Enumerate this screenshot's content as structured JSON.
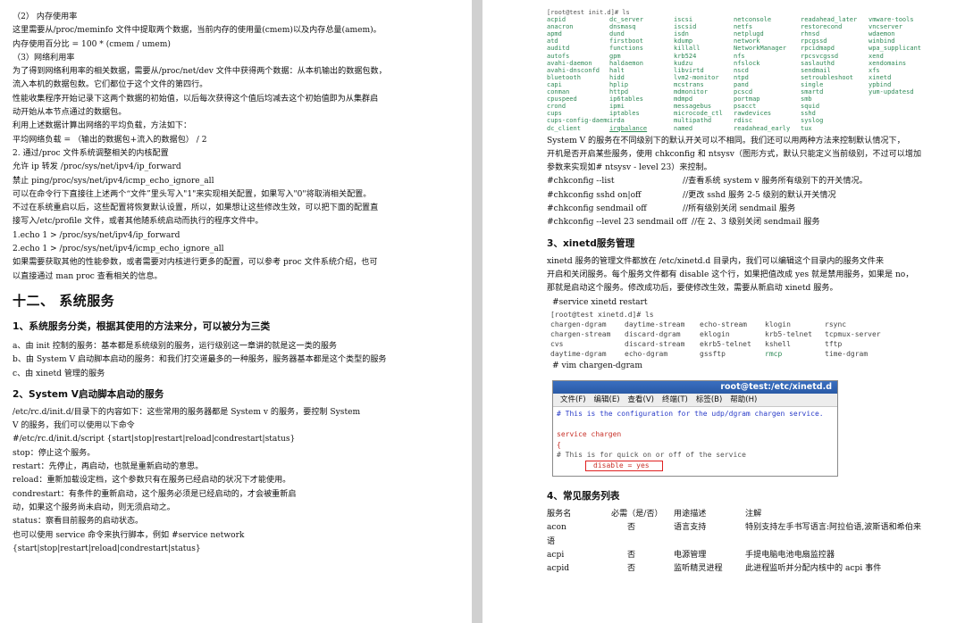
{
  "left": {
    "lines": [
      {
        "k": "ln",
        "t": "（2）      内存使用率"
      },
      {
        "k": "ln",
        "t": "这里需要从/proc/meminfo 文件中提取两个数据，当前内存的使用量(cmem)以及内存总量(amem)。"
      },
      {
        "k": "ln",
        "t": "内存使用百分比      =      100      *      (cmem      /      umem)"
      },
      {
        "k": "ln",
        "t": "（3）网络利用率"
      },
      {
        "k": "ln",
        "t": "为了得到网络利用率的相关数据，需要从/proc/net/dev 文件中获得两个数据：从本机输出的数据包数，"
      },
      {
        "k": "ln",
        "t": "流入本机的数据包数。它们都位于这个文件的第四行。"
      },
      {
        "k": "ln",
        "t": "性能收集程序开始记录下这两个数据的初始值，以后每次获得这个值后均减去这个初始值即为从集群启"
      },
      {
        "k": "ln",
        "t": "动开始从本节点通过的数据包。"
      },
      {
        "k": "ln",
        "t": "利用上述数据计算出网络的平均负载，方法如下："
      },
      {
        "k": "ln",
        "t": "平均网络负载      =      （输出的数据包+流入的数据包）      /      2"
      },
      {
        "k": "ln",
        "t": "2. 通过/proc 文件系统调整相关的内核配置"
      },
      {
        "k": "ln",
        "t": "允许 ip 转发      /proc/sys/net/ipv4/ip_forward"
      },
      {
        "k": "ln",
        "t": "禁止 ping/proc/sys/net/ipv4/icmp_echo_ignore_all"
      },
      {
        "k": "ln",
        "t": "可以在命令行下直接往上述两个“文件”里头写入\"1\"来实现相关配置，如果写入\"0\"将取消相关配置。"
      },
      {
        "k": "ln",
        "t": "不过在系统重启以后，这些配置将恢复默认设置，所以，如果想让这些修改生效，可以把下面的配置直"
      },
      {
        "k": "ln",
        "t": "接写入/etc/profile 文件，或者其他随系统启动而执行的程序文件中。"
      },
      {
        "k": "ln",
        "t": "1.echo 1 > /proc/sys/net/ipv4/ip_forward"
      },
      {
        "k": "ln",
        "t": "2.echo 1 > /proc/sys/net/ipv4/icmp_echo_ignore_all"
      },
      {
        "k": "ln",
        "t": "如果需要获取其他的性能参数，或者需要对内核进行更多的配置，可以参考 proc 文件系统介绍，也可"
      },
      {
        "k": "ln",
        "t": "以直接通过 man proc 查看相关的信息。"
      },
      {
        "k": "h1",
        "t": "十二、 系统服务"
      },
      {
        "k": "h2",
        "t": "1、系统服务分类，根据其使用的方法来分，可以被分为三类"
      },
      {
        "k": "ln",
        "t": "a、由 init 控制的服务：基本都是系统级别的服务，运行级别这一章讲的就是这一类的服务"
      },
      {
        "k": "ln",
        "t": "b、由 System V 启动脚本启动的服务：和我们打交道最多的一种服务，服务器基本都是这个类型的服务"
      },
      {
        "k": "ln",
        "t": "c、由 xinetd 管理的服务"
      },
      {
        "k": "h3",
        "t": "2、System V启动脚本启动的服务"
      },
      {
        "k": "ln",
        "t": "        /etc/rc.d/init.d/目录下的内容如下：这些常用的服务器都是 System v 的服务，要控制 System"
      },
      {
        "k": "ln",
        "t": "V 的服务，我们可以使用以下命令"
      },
      {
        "k": "ln",
        "t": "#/etc/rc.d/init.d/script     {start|stop|restart|reload|condrestart|status}"
      },
      {
        "k": "ln",
        "t": "stop：停止这个服务。"
      },
      {
        "k": "ln",
        "t": "restart：先停止，再启动，也就是重新启动的意思。"
      },
      {
        "k": "ln",
        "t": "reload：重新加载设定档，这个参数只有在服务已经启动的状况下才能使用。"
      },
      {
        "k": "ln",
        "t": "condrestart：有条件的重新启动，这个服务必须是已经启动的，才会被重新启"
      },
      {
        "k": "ln",
        "t": "动，如果这个服务尚未启动，则无须启动之。"
      },
      {
        "k": "ln",
        "t": "status：察看目前服务的启动状态。"
      },
      {
        "k": "ln",
        "t": "也可以使用 service 命令来执行脚本，例如 #service network"
      },
      {
        "k": "ln",
        "t": "{start|stop|restart|reload|condrestart|status}"
      }
    ]
  },
  "right": {
    "prompt1": "[root@test init.d]# ls",
    "listing": [
      "acpid",
      "dc_server",
      "iscsi",
      "netconsole",
      "readahead_later",
      "vmware-tools",
      "anacron",
      "dnsmasq",
      "iscsid",
      "netfs",
      "restorecond",
      "vncserver",
      "apmd",
      "dund",
      "isdn",
      "netplugd",
      "rhnsd",
      "wdaemon",
      "atd",
      "firstboot",
      "kdump",
      "network",
      "rpcgssd",
      "winbind",
      "auditd",
      "functions",
      "killall",
      "NetworkManager",
      "rpcidmapd",
      "wpa_supplicant",
      "autofs",
      "gpm",
      "krb524",
      "nfs",
      "rpcsvcgssd",
      "xend",
      "avahi-daemon",
      "haldaemon",
      "kudzu",
      "nfslock",
      "saslauthd",
      "xendomains",
      "avahi-dnsconfd",
      "halt",
      "libvirtd",
      "nscd",
      "sendmail",
      "xfs",
      "bluetooth",
      "hidd",
      "lvm2-monitor",
      "ntpd",
      "setroubleshoot",
      "xinetd",
      "capi",
      "hplip",
      "mcstrans",
      "pand",
      "single",
      "ypbind",
      "conman",
      "httpd",
      "mdmonitor",
      "pcscd",
      "smartd",
      "yum-updatesd",
      "cpuspeed",
      "ip6tables",
      "mdmpd",
      "portmap",
      "smb",
      "",
      "crond",
      "ipmi",
      "messagebus",
      "psacct",
      "squid",
      "",
      "cups",
      "iptables",
      "microcode_ctl",
      "rawdevices",
      "sshd",
      "",
      "cups-config-daemon",
      "irda",
      "multipathd",
      "rdisc",
      "syslog",
      "",
      "dc_client",
      "irqbalance",
      "named",
      "readahead_early",
      "tux",
      ""
    ],
    "para1": [
      "System V 的服务在不同级别下的默认开关可以不相同。我们还可以用两种方法来控制默认情况下，",
      "开机是否开启某些服务，使用 chkconfig 和 ntsysv（图形方式，默认只能定义当前级别，不过可以增加",
      "参数来实现如#  ntsysv  - level 23）来控制。"
    ],
    "cmds": [
      {
        "c": "#chkconfig --list",
        "d": "//查看系统 system v 服务所有级别下的开关情况。"
      },
      {
        "c": "#chkconfig sshd on|off",
        "d": "//更改 sshd 服务 2-5 级别的默认开关情况"
      },
      {
        "c": "#chkconfig sendmail off",
        "d": "//所有级别关闭 sendmail 服务"
      },
      {
        "c": "#chkconfig --level 23 sendmail off",
        "d": "//在 2、3 级别关闭 sendmail 服务"
      }
    ],
    "xinetd_title": "3、xinetd服务管理",
    "para2": [
      "        xinetd 服务的管理文件都放在 /etc/xinetd.d 目录内，我们可以编辑这个目录内的服务文件来",
      "开启和关闭服务。每个服务文件都有 disable 这个行，如果把值改成 yes 就是禁用服务，如果是 no，",
      "那就是启动这个服务。修改成功后，要使修改生效，需要从新启动 xinetd 服务。"
    ],
    "restart_cmd": "#service xinetd restart",
    "prompt2": "[root@test xinetd.d]# ls",
    "listing2": [
      "chargen-dgram",
      "daytime-stream",
      "echo-stream",
      "klogin",
      "rsync",
      "chargen-stream",
      "discard-dgram",
      "eklogin",
      "krb5-telnet",
      "tcpmux-server",
      "cvs",
      "discard-stream",
      "ekrb5-telnet",
      "kshell",
      "tftp",
      "daytime-dgram",
      "echo-dgram",
      "gssftp",
      "rmcp",
      "time-dgram"
    ],
    "vim_cmd": "# vim chargen-dgram",
    "editor": {
      "title": "root@test:/etc/xinetd.d",
      "menu": [
        "文件(F)",
        "编辑(E)",
        "查看(V)",
        "终端(T)",
        "标签(B)",
        "帮助(H)"
      ],
      "line1": "# This is the configuration for the udp/dgram chargen service.",
      "line2": "service chargen",
      "line3": "{",
      "line4": "# This is for quick on or off of the service",
      "line5": "disable         = yes"
    },
    "svc_title": "4、常见服务列表",
    "svc_header": [
      "服务名",
      "必需（是/否）",
      "用途描述",
      "注解"
    ],
    "svc_rows": [
      [
        "acon",
        "否",
        "语言支持",
        "特别支持左手书写语言:阿拉伯语,波斯语和希伯来"
      ],
      [
        "语",
        "",
        "",
        ""
      ],
      [
        "acpi",
        "否",
        "电源管理",
        "手提电脑电池电扇监控器"
      ],
      [
        "acpid",
        "否",
        "监听精灵进程",
        "此进程监听并分配内核中的 acpi 事件"
      ]
    ]
  }
}
